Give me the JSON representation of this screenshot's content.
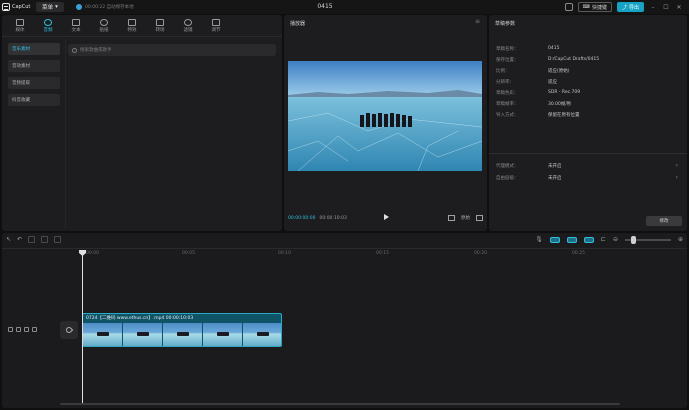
{
  "app": {
    "logo_text": "CapCut",
    "menu_label": "菜单",
    "save_status": "00:00:22 自动保存本地",
    "project_title": "0415",
    "shortcut_label": "快捷键",
    "export_label": "导出"
  },
  "toolbar": {
    "tools": [
      {
        "label": "媒体",
        "icon": "media-icon"
      },
      {
        "label": "音频",
        "icon": "audio-icon"
      },
      {
        "label": "文本",
        "icon": "text-icon"
      },
      {
        "label": "贴纸",
        "icon": "sticker-icon"
      },
      {
        "label": "特效",
        "icon": "effects-icon"
      },
      {
        "label": "转场",
        "icon": "transition-icon"
      },
      {
        "label": "滤镜",
        "icon": "filter-icon"
      },
      {
        "label": "调节",
        "icon": "adjust-icon"
      }
    ]
  },
  "media_nav": {
    "items": [
      "音乐素材",
      "音效素材",
      "音频提取",
      "抖音收藏"
    ],
    "search_placeholder": "搜索歌曲或歌手"
  },
  "player": {
    "title": "播放器",
    "current_time": "00:00:00:00",
    "total_time": "00:00:10:03",
    "ratio_label": "原始"
  },
  "properties": {
    "title": "草稿参数",
    "rows": [
      {
        "key": "草稿名称：",
        "value": "0415"
      },
      {
        "key": "保存位置：",
        "value": "D:/CapCut Drafts/0415"
      },
      {
        "key": "比例：",
        "value": "适应(原始)"
      },
      {
        "key": "分辨率：",
        "value": "适应"
      },
      {
        "key": "草稿色彩：",
        "value": "SDR - Rec.709"
      },
      {
        "key": "草稿帧率：",
        "value": "30.00帧/秒"
      },
      {
        "key": "导入方式：",
        "value": "保留在原有位置"
      }
    ],
    "rows2": [
      {
        "key": "代理模式：",
        "value": "未开启"
      },
      {
        "key": "自由层级：",
        "value": "未开启"
      }
    ],
    "modify_label": "修改"
  },
  "timeline": {
    "ruler_labels": [
      "00:00",
      "00:05",
      "00:10",
      "00:15",
      "00:20",
      "00:25"
    ],
    "clip_label": "0724【二维码 www.ethus.cn】.mp4   00:00:10:03"
  }
}
